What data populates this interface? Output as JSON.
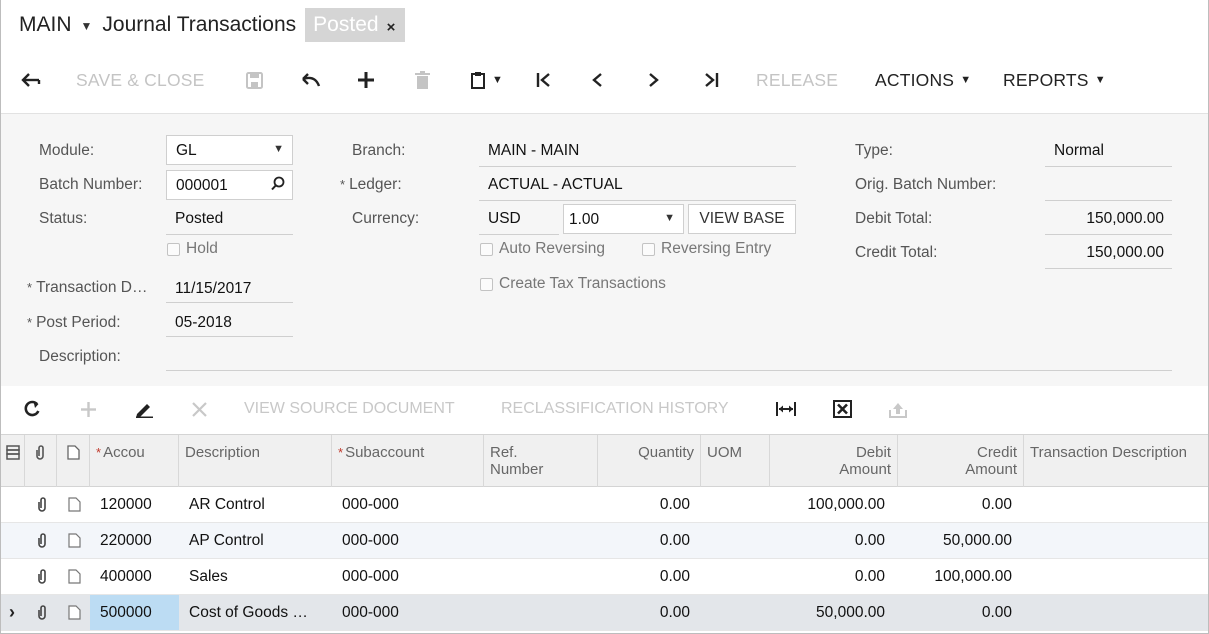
{
  "title": {
    "company": "MAIN",
    "screen": "Journal Transactions",
    "status_chip": "Posted",
    "close_glyph": "×"
  },
  "toolbar": {
    "save_close": "SAVE & CLOSE",
    "release": "RELEASE",
    "actions": "ACTIONS",
    "reports": "REPORTS",
    "icons": [
      "back-arrow-icon",
      "save-icon",
      "undo-icon",
      "plus-icon",
      "trash-icon",
      "clipboard-icon",
      "first-icon",
      "previous-icon",
      "next-icon",
      "last-icon"
    ]
  },
  "form": {
    "module_label": "Module:",
    "module_value": "GL",
    "batch_label": "Batch Number:",
    "batch_value": "000001",
    "status_label": "Status:",
    "status_value": "Posted",
    "hold_label": "Hold",
    "trans_date_label": "Transaction D…",
    "trans_date_value": "11/15/2017",
    "post_period_label": "Post Period:",
    "post_period_value": "05-2018",
    "description_label": "Description:",
    "description_value": "",
    "branch_label": "Branch:",
    "branch_value": "MAIN - MAIN",
    "ledger_label": "Ledger:",
    "ledger_value": "ACTUAL - ACTUAL",
    "currency_label": "Currency:",
    "currency_value": "USD",
    "rate_value": "1.00",
    "view_base": "VIEW BASE",
    "auto_reversing": "Auto Reversing",
    "reversing_entry": "Reversing Entry",
    "create_tax": "Create Tax Transactions",
    "type_label": "Type:",
    "type_value": "Normal",
    "orig_batch_label": "Orig. Batch Number:",
    "orig_batch_value": "",
    "debit_total_label": "Debit Total:",
    "debit_total_value": "150,000.00",
    "credit_total_label": "Credit Total:",
    "credit_total_value": "150,000.00"
  },
  "grid_toolbar": {
    "view_source": "VIEW SOURCE DOCUMENT",
    "reclass_history": "RECLASSIFICATION HISTORY"
  },
  "grid": {
    "headers": {
      "account": "Accou",
      "description": "Description",
      "subaccount": "Subaccount",
      "ref_line1": "Ref.",
      "ref_line2": "Number",
      "quantity": "Quantity",
      "uom": "UOM",
      "debit_line1": "Debit",
      "debit_line2": "Amount",
      "credit_line1": "Credit",
      "credit_line2": "Amount",
      "trans_desc": "Transaction Description"
    },
    "rows": [
      {
        "account": "120000",
        "description": "AR Control",
        "subaccount": "000-000",
        "ref": "",
        "quantity": "0.00",
        "uom": "",
        "debit": "100,000.00",
        "credit": "0.00",
        "trans_desc": ""
      },
      {
        "account": "220000",
        "description": "AP Control",
        "subaccount": "000-000",
        "ref": "",
        "quantity": "0.00",
        "uom": "",
        "debit": "0.00",
        "credit": "50,000.00",
        "trans_desc": ""
      },
      {
        "account": "400000",
        "description": "Sales",
        "subaccount": "000-000",
        "ref": "",
        "quantity": "0.00",
        "uom": "",
        "debit": "0.00",
        "credit": "100,000.00",
        "trans_desc": ""
      },
      {
        "account": "500000",
        "description": "Cost of Goods …",
        "subaccount": "000-000",
        "ref": "",
        "quantity": "0.00",
        "uom": "",
        "debit": "50,000.00",
        "credit": "0.00",
        "trans_desc": ""
      }
    ],
    "selected_row": 3,
    "row_marker": "›"
  },
  "colors": {
    "chip_bg": "#d5d5d5",
    "form_bg": "#f6f6f6",
    "selected_cell": "#bcdcf3",
    "disabled_text": "#c4c4c4"
  }
}
